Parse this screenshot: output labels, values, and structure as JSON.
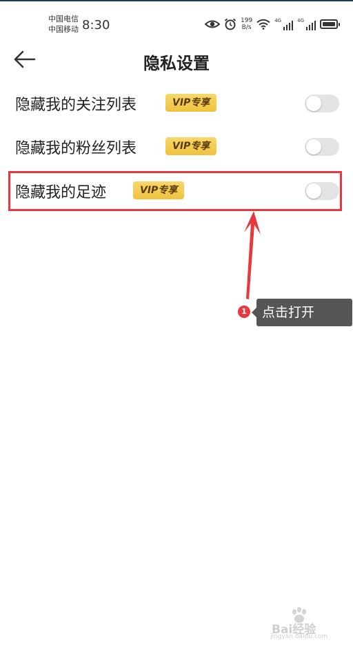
{
  "status_bar": {
    "carrier1": "中国电信",
    "carrier2": "中国移动",
    "time": "8:30",
    "net_speed_value": "199",
    "net_speed_unit": "B/s",
    "sig1_label": "4G",
    "sig2_label": "4G",
    "icons": [
      "eye-icon",
      "alarm-icon",
      "wifi-icon",
      "signal-icon",
      "signal-icon",
      "battery-charging-icon"
    ]
  },
  "header": {
    "title": "隐私设置",
    "back_icon": "arrow-left-icon"
  },
  "settings": [
    {
      "label": "隐藏我的关注列表",
      "badge": "VIP专享",
      "toggle_on": false
    },
    {
      "label": "隐藏我的粉丝列表",
      "badge": "VIP专享",
      "toggle_on": false
    },
    {
      "label": "隐藏我的足迹",
      "badge": "VIP专享",
      "toggle_on": false
    }
  ],
  "annotation": {
    "step_number": "1",
    "tooltip_text": "点击打开",
    "color": "#e8383d"
  },
  "watermark": {
    "text": "Bai经验",
    "url": "jingyan.baidu.com"
  },
  "colors": {
    "badge_bg": "#efc23e",
    "toggle_off": "#e4e4e4",
    "highlight": "#e8383d",
    "tooltip_bg": "#555555"
  }
}
